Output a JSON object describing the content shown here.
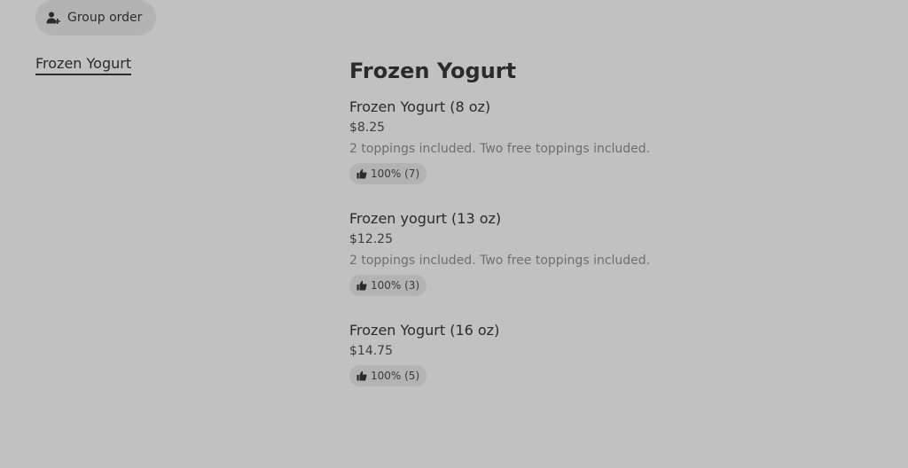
{
  "header": {
    "group_order_label": "Group order",
    "group_order_icon": "person-add-icon"
  },
  "sidebar": {
    "items": [
      {
        "label": "Frozen Yogurt",
        "active": true
      }
    ]
  },
  "menu": {
    "section_title": "Frozen Yogurt",
    "items": [
      {
        "name": "Frozen Yogurt (8 oz)",
        "price": "$8.25",
        "description": "2 toppings included. Two free toppings included.",
        "rating": "100% (7)",
        "rating_icon": "thumbs-up-icon"
      },
      {
        "name": "Frozen yogurt (13 oz)",
        "price": "$12.25",
        "description": "2 toppings included. Two free toppings included.",
        "rating": "100% (3)",
        "rating_icon": "thumbs-up-icon"
      },
      {
        "name": "Frozen Yogurt (16 oz)",
        "price": "$14.75",
        "description": "",
        "rating": "100% (5)",
        "rating_icon": "thumbs-up-icon"
      }
    ]
  },
  "colors": {
    "background": "#c1c1c1",
    "pill": "#b3b3b3",
    "text": "#2b2b2b",
    "muted": "#6e6e6e"
  }
}
